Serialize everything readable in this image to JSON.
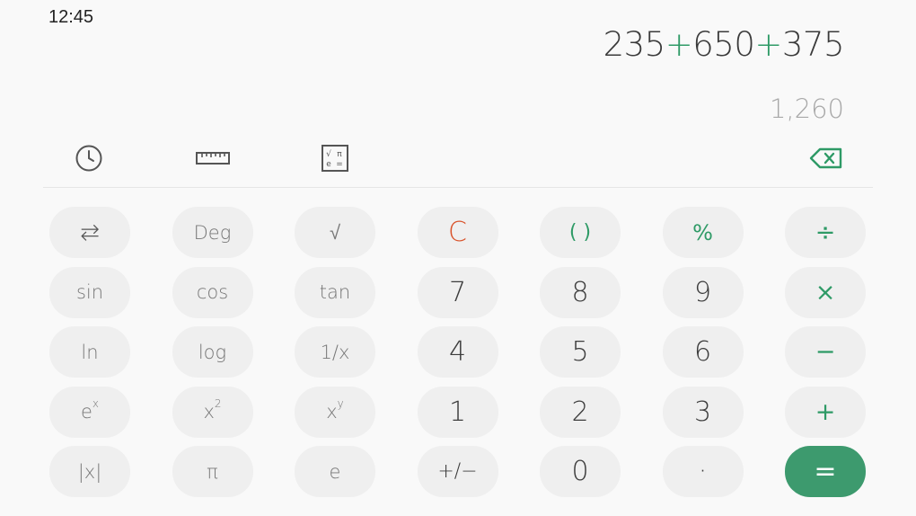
{
  "status_bar": {
    "time": "12:45"
  },
  "display": {
    "expression_parts": [
      {
        "text": "235",
        "kind": "num"
      },
      {
        "text": "+",
        "kind": "op"
      },
      {
        "text": "650",
        "kind": "num"
      },
      {
        "text": "+",
        "kind": "op"
      },
      {
        "text": "375",
        "kind": "num"
      }
    ],
    "result": "1,260"
  },
  "toolbar": {
    "icons": [
      "history-icon",
      "ruler-icon",
      "scientific-toggle-icon",
      "backspace-icon"
    ]
  },
  "keypad": {
    "rows": [
      [
        "⇆",
        "Deg",
        "√",
        "C",
        "( )",
        "%",
        "÷"
      ],
      [
        "sin",
        "cos",
        "tan",
        "7",
        "8",
        "9",
        "×"
      ],
      [
        "ln",
        "log",
        "1/x",
        "4",
        "5",
        "6",
        "−"
      ],
      [
        "e^x",
        "x^2",
        "x^y",
        "1",
        "2",
        "3",
        "+"
      ],
      [
        "|x|",
        "π",
        "e",
        "+/−",
        "0",
        "·",
        "="
      ]
    ]
  },
  "colors": {
    "accent": "#2e9a66",
    "clear": "#d9532b",
    "equals_bg": "#3d9a6e"
  }
}
